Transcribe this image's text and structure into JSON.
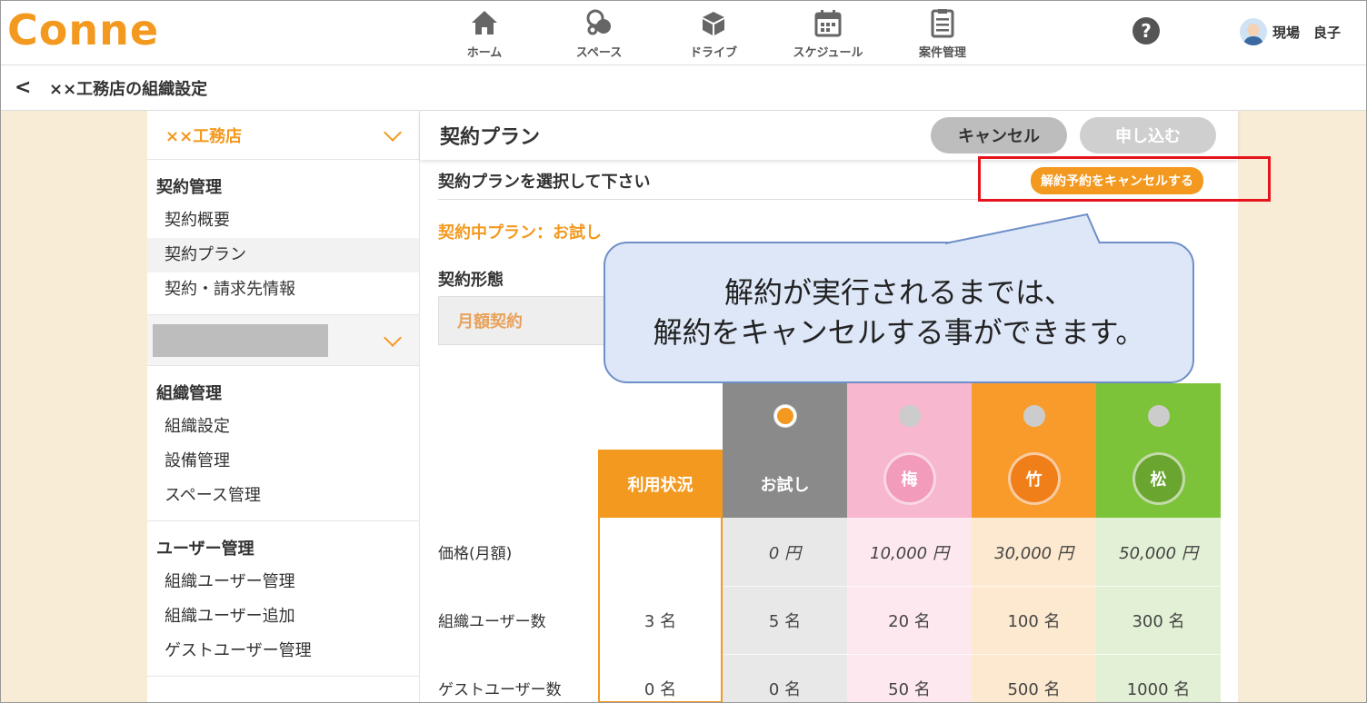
{
  "header": {
    "logo": "Conne",
    "nav": [
      {
        "label": "ホーム",
        "icon": "home-icon"
      },
      {
        "label": "スペース",
        "icon": "space-icon"
      },
      {
        "label": "ドライブ",
        "icon": "drive-icon"
      },
      {
        "label": "スケジュール",
        "icon": "calendar-icon"
      },
      {
        "label": "案件管理",
        "icon": "clipboard-icon"
      }
    ],
    "help": "?",
    "user_name": "現場　良子"
  },
  "subbar": {
    "back": "<",
    "title": "××工務店の組織設定"
  },
  "sidebar": {
    "org_name": "××工務店",
    "sections": [
      {
        "title": "契約管理",
        "items": [
          "契約概要",
          "契約プラン",
          "契約・請求先情報"
        ]
      },
      {
        "title": "組織管理",
        "items": [
          "組織設定",
          "設備管理",
          "スペース管理"
        ]
      },
      {
        "title": "ユーザー管理",
        "items": [
          "組織ユーザー管理",
          "組織ユーザー追加",
          "ゲストユーザー管理"
        ]
      }
    ]
  },
  "main": {
    "title": "契約プラン",
    "cancel_label": "キャンセル",
    "apply_label": "申し込む",
    "select_prompt": "契約プランを選択して下さい",
    "cancel_termination_label": "解約予約をキャンセルする",
    "current_plan": "契約中プラン：お試し",
    "form_label": "契約形態",
    "form_value": "月額契約"
  },
  "table": {
    "usage_header": "利用状況",
    "row_labels": [
      "価格(月額)",
      "組織ユーザー数",
      "ゲストユーザー数"
    ],
    "usage_values": [
      "",
      "3 名",
      "0 名"
    ],
    "plans": [
      {
        "name": "お試し",
        "badge": "",
        "price": "0 円",
        "users": "5 名",
        "guests": "0 名",
        "head_color": "#8a8a8a",
        "body_color": "#e8e8e8"
      },
      {
        "name": "",
        "badge": "梅",
        "price": "10,000 円",
        "users": "20 名",
        "guests": "50 名",
        "head_color": "#f7b7cf",
        "body_color": "#fde8f0"
      },
      {
        "name": "",
        "badge": "竹",
        "price": "30,000 円",
        "users": "100 名",
        "guests": "500 名",
        "head_color": "#f99b2a",
        "body_color": "#fde9cf"
      },
      {
        "name": "",
        "badge": "松",
        "price": "50,000 円",
        "users": "300 名",
        "guests": "1000 名",
        "head_color": "#7dc33a",
        "body_color": "#e2f1d5"
      }
    ]
  },
  "callout": {
    "line1": "解約が実行されるまでは、",
    "line2": "解約をキャンセルする事ができます。"
  }
}
